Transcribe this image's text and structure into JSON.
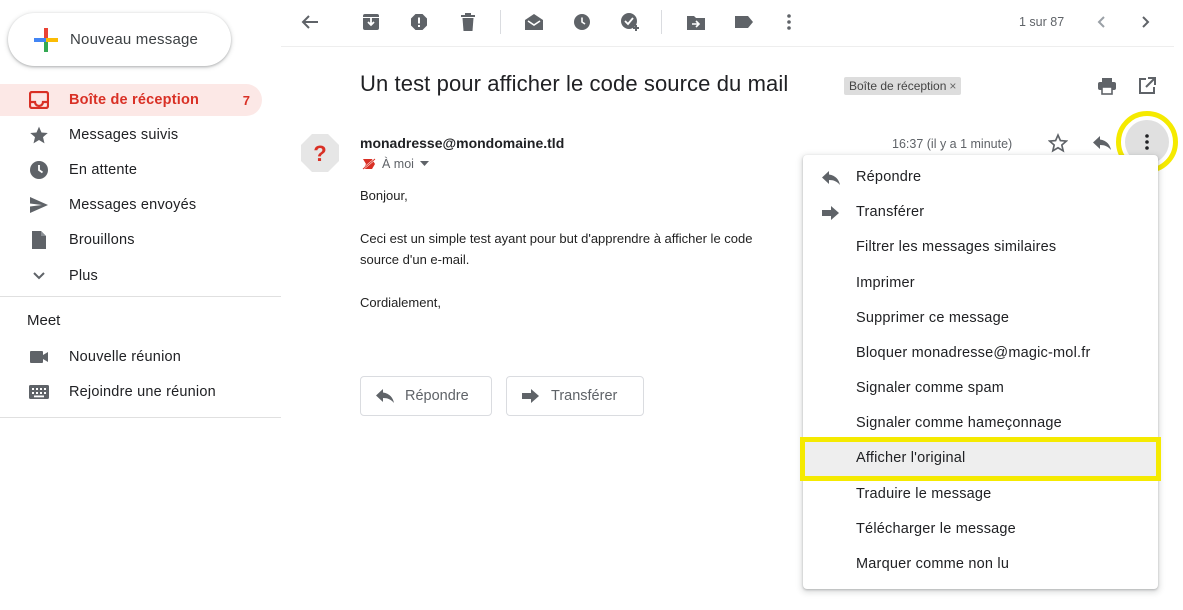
{
  "sidebar": {
    "compose_label": "Nouveau message",
    "items": [
      {
        "label": "Boîte de réception",
        "count": "7"
      },
      {
        "label": "Messages suivis"
      },
      {
        "label": "En attente"
      },
      {
        "label": "Messages envoyés"
      },
      {
        "label": "Brouillons"
      },
      {
        "label": "Plus"
      }
    ],
    "meet": {
      "title": "Meet",
      "items": [
        {
          "label": "Nouvelle réunion"
        },
        {
          "label": "Rejoindre une réunion"
        }
      ]
    }
  },
  "toolbar": {
    "pager": "1 sur 87"
  },
  "mail": {
    "subject": "Un test pour afficher le code source du mail",
    "label_chip": "Boîte de réception",
    "label_chip_close": "×",
    "sender": "monadresse@mondomaine.tld",
    "avatar_glyph": "?",
    "to": "À moi",
    "time": "16:37 (il y a 1 minute)",
    "body": {
      "greeting": "Bonjour,",
      "line1": "Ceci est un simple test ayant pour but d'apprendre à afficher le code",
      "line2": "source d'un e-mail.",
      "closing": "Cordialement,"
    },
    "reply_button": "Répondre",
    "forward_button": "Transférer"
  },
  "menu": {
    "items": [
      {
        "label": "Répondre",
        "icon": "reply-icon"
      },
      {
        "label": "Transférer",
        "icon": "forward-icon"
      },
      {
        "label": "Filtrer les messages similaires"
      },
      {
        "label": "Imprimer"
      },
      {
        "label": "Supprimer ce message"
      },
      {
        "label": "Bloquer monadresse@magic-mol.fr"
      },
      {
        "label": "Signaler comme spam"
      },
      {
        "label": "Signaler comme hameçonnage"
      },
      {
        "label": "Afficher l'original",
        "highlighted": true
      },
      {
        "label": "Traduire le message"
      },
      {
        "label": "Télécharger le message"
      },
      {
        "label": "Marquer comme non lu"
      }
    ]
  },
  "colors": {
    "active_nav_bg": "#fce8e6",
    "active_nav_text": "#d93025",
    "highlight_yellow": "#f5ea00",
    "icon_grey": "#5f6368"
  }
}
